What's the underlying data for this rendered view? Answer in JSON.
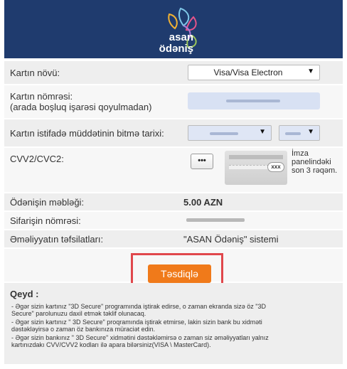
{
  "header": {
    "logo_line1": "asan",
    "logo_line2": "ödəniş",
    "bg_color": "#1f3b6e"
  },
  "form": {
    "card_type": {
      "label": "Kartın növü:",
      "value": "Visa/Visa Electron"
    },
    "card_number": {
      "label_line1": "Kartın nömrəsi:",
      "label_line2": "(arada boşluq işarəsi qoyulmadan)"
    },
    "expiry": {
      "label": "Kartın istifadə müddətinin bitmə tarixi:"
    },
    "cvv": {
      "label": "CVV2/CVC2:",
      "button": "•••",
      "card_badge": "xxx",
      "hint_line1": "İmza",
      "hint_line2": "panelindəki",
      "hint_line3": "son 3 rəqəm."
    },
    "amount": {
      "label": "Ödənişin məbləği:",
      "value": "5.00 AZN"
    },
    "order_number": {
      "label": "Sifarişin nömrəsi:"
    },
    "details": {
      "label": "Əməliyyatın təfsilatları:",
      "value": "\"ASAN Ödəniş\" sistemi"
    }
  },
  "confirm_button": {
    "label": "Təsdiqlə",
    "color": "#f07a1a"
  },
  "notes": {
    "title": "Qeyd :",
    "lines": [
      "- Əgər sizin kartınız \"3D Secure\" programında iştirak edirse, o zaman ekranda sizə öz \"3D",
      "  Secure\" parolunuzu daxil etmək təklif olunacaq.",
      "- Əgər sizin kartınız \" 3D Secure\" proqramında iştirak etmirse, lakin sizin bank bu xidməti",
      "  dəstəkləyirsə o zaman öz bankınıza müraciət edin.",
      "- Əgər sizin bankınız \" 3D Secure\" xidmətini dəstəkləmirsə o zaman siz əməliyyatları yalnız",
      "  kartınızdakı CVV/CVV2 kodları ilə apara bilərsiniz(VISA \\ MasterCard)."
    ]
  }
}
